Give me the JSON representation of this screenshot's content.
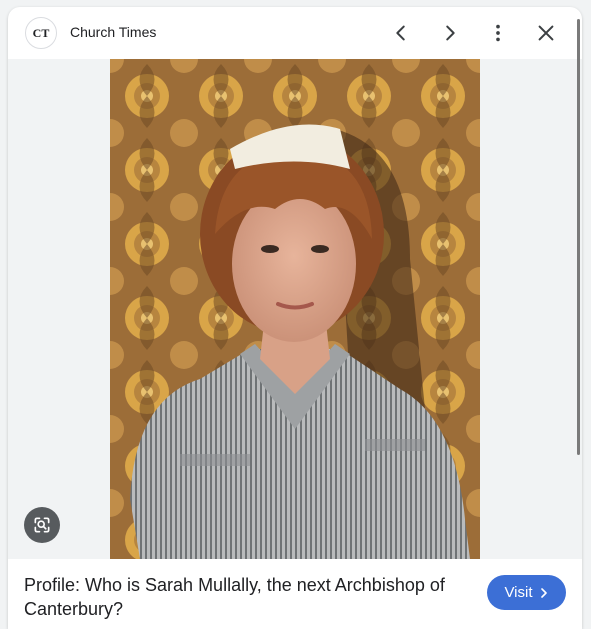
{
  "header": {
    "logo_text": "CT",
    "source_name": "Church Times",
    "prev_icon": "chevron-left-icon",
    "next_icon": "chevron-right-icon",
    "more_icon": "more-vert-icon",
    "close_icon": "close-icon"
  },
  "image": {
    "lens_icon": "lens-search-icon"
  },
  "caption": {
    "title": "Profile: Who is Sarah Mullally, the next Archbishop of Canterbury?"
  },
  "actions": {
    "visit_label": "Visit",
    "visit_icon": "chevron-right-icon"
  },
  "colors": {
    "accent": "#3c6fd6",
    "background": "#f1f3f4"
  }
}
